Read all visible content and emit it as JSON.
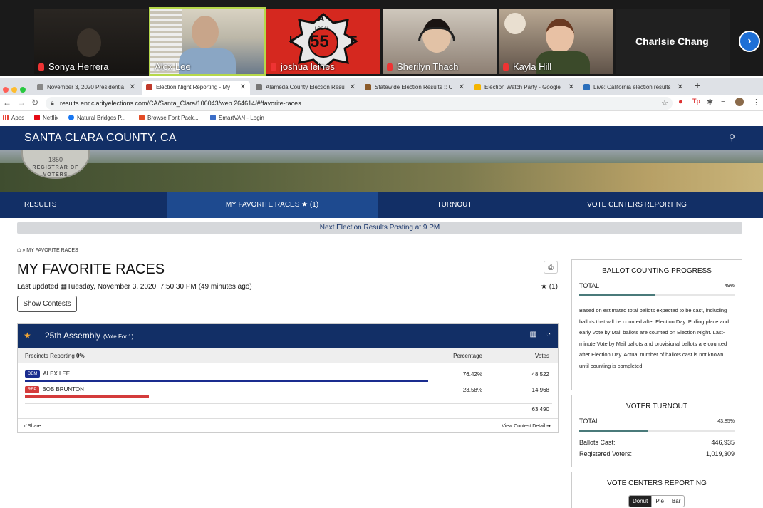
{
  "video": {
    "participants": [
      {
        "name": "Sonya Herrera",
        "muted": true
      },
      {
        "name": "Alex Lee",
        "muted": false,
        "active": true
      },
      {
        "name": "joshua leines",
        "muted": true
      },
      {
        "name": "Sherilyn Thach",
        "muted": true
      },
      {
        "name": "Kayla Hill",
        "muted": true
      }
    ],
    "tile_logo": {
      "top": "A",
      "left": "I",
      "right": "F",
      "center": "55",
      "small": "LOCAL"
    },
    "name_only": "Charlsie Chang"
  },
  "browser": {
    "tabs": [
      {
        "label": "November 3, 2020 Presidentia",
        "color": "#888"
      },
      {
        "label": "Election Night Reporting - My",
        "color": "#c0392b"
      },
      {
        "label": "Alameda County Election Resu",
        "color": "#777"
      },
      {
        "label": "Statewide Election Results :: C",
        "color": "#8a5a2a"
      },
      {
        "label": "Election Watch Party - Google",
        "color": "#f4b400"
      },
      {
        "label": "Live: California election results",
        "color": "#2a6ebb"
      }
    ],
    "url": "results.enr.clarityelections.com/CA/Santa_Clara/106043/web.264614/#/favorite-races",
    "bookmarks": [
      {
        "label": "Apps",
        "color": "#e94235"
      },
      {
        "label": "Netflix",
        "color": "#e50914"
      },
      {
        "label": "Natural Bridges P...",
        "color": "#1877f2"
      },
      {
        "label": "Browse Font Pack...",
        "color": "#e34c26"
      },
      {
        "label": "SmartVAN - Login",
        "color": "#3b6dc7"
      }
    ]
  },
  "site": {
    "title": "SANTA CLARA COUNTY, CA",
    "seal_text": "1850",
    "seal_arc": "REGISTRAR OF VOTERS",
    "nav": [
      {
        "label": "RESULTS"
      },
      {
        "label": "MY FAVORITE RACES ★ (1)",
        "active": true
      },
      {
        "label": "TURNOUT"
      },
      {
        "label": "VOTE CENTERS REPORTING"
      }
    ],
    "notice": "Next Election Results Posting at 9 PM"
  },
  "main": {
    "breadcrumb": "MY FAVORITE RACES",
    "title": "MY FAVORITE RACES",
    "last_updated_label": "Last updated",
    "last_updated": "Tuesday, November 3, 2020, 7:50:30 PM",
    "ago": "(49 minutes ago)",
    "fav_count": "(1)",
    "show_contests": "Show Contests"
  },
  "race": {
    "name": "25th Assembly",
    "vote_for": "(Vote For 1)",
    "precincts_label": "Precincts Reporting",
    "precincts_value": "0%",
    "col_pct": "Percentage",
    "col_votes": "Votes",
    "candidates": [
      {
        "party": "DEM",
        "name": "ALEX LEE",
        "pct": "76.42%",
        "share": 0.7642,
        "votes": "48,522",
        "color": "#1a2c8f"
      },
      {
        "party": "REP",
        "name": "BOB BRUNTON",
        "pct": "23.58%",
        "share": 0.2358,
        "votes": "14,968",
        "color": "#d43b3b"
      }
    ],
    "total_votes": "63,490",
    "share": "Share",
    "view_detail": "View Contest Detail"
  },
  "sidebar": {
    "progress": {
      "title": "BALLOT COUNTING PROGRESS",
      "label": "TOTAL",
      "value": "49%",
      "fraction": 0.49,
      "note": "Based on estimated total ballots expected to be cast, including ballots that will be counted after Election Day. Polling place and early Vote by Mail ballots are counted on Election Night. Last-minute Vote by Mail ballots and provisional ballots are counted after Election Day. Actual number of ballots cast is not known until counting is completed."
    },
    "turnout": {
      "title": "VOTER TURNOUT",
      "label": "TOTAL",
      "value": "43.85%",
      "fraction": 0.4385,
      "ballots_label": "Ballots Cast:",
      "ballots": "446,935",
      "registered_label": "Registered Voters:",
      "registered": "1,019,309"
    },
    "centers": {
      "title": "VOTE CENTERS REPORTING",
      "options": [
        "Donut",
        "Pie",
        "Bar"
      ],
      "selected": "Donut"
    }
  }
}
